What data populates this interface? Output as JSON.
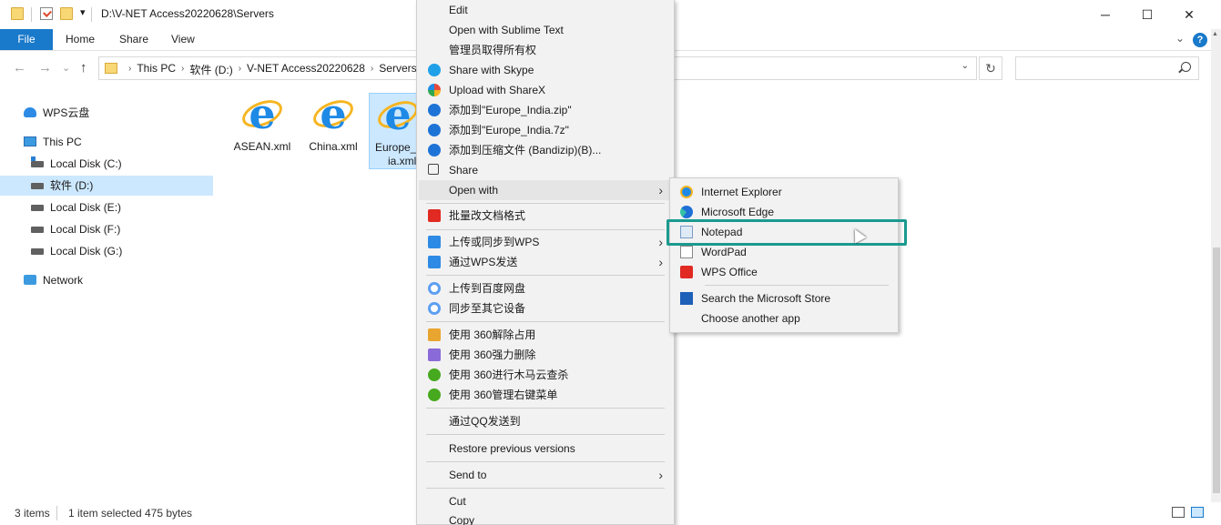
{
  "titlebar": {
    "path": "D:\\V-NET Access20220628\\Servers",
    "qa_dropdown": "▾",
    "minimize": "─",
    "maximize": "☐",
    "close": "✕"
  },
  "ribbon": {
    "tabs": [
      "File",
      "Home",
      "Share",
      "View"
    ],
    "collapse": "⌄",
    "help": "?"
  },
  "nav": {
    "back": "←",
    "forward": "→",
    "recent": "⌄",
    "up": "↑",
    "breadcrumbs": [
      "This PC",
      "软件 (D:)",
      "V-NET Access20220628",
      "Servers"
    ],
    "crumb_sep": "›",
    "dropdown": "⌄",
    "refresh": "↻",
    "search_placeholder": ""
  },
  "navpane": {
    "items": [
      {
        "label": "WPS云盘",
        "icon": "cloud-icon"
      },
      {
        "label": "This PC",
        "icon": "computer-icon"
      },
      {
        "label": "Local Disk (C:)",
        "icon": "system-disk-icon"
      },
      {
        "label": "软件 (D:)",
        "icon": "disk-icon",
        "selected": true
      },
      {
        "label": "Local Disk (E:)",
        "icon": "disk-icon"
      },
      {
        "label": "Local Disk (F:)",
        "icon": "disk-icon"
      },
      {
        "label": "Local Disk (G:)",
        "icon": "disk-icon"
      },
      {
        "label": "Network",
        "icon": "network-icon"
      }
    ]
  },
  "files": [
    {
      "name": "ASEAN.xml",
      "icon": "internet-explorer-icon"
    },
    {
      "name": "China.xml",
      "icon": "internet-explorer-icon"
    },
    {
      "name": "Europe_India.xml",
      "display_line1": "Europe_I",
      "display_line2": "ia.xml",
      "icon": "internet-explorer-icon",
      "selected": true
    }
  ],
  "status": {
    "items_count": "3 items",
    "selection": "1 item selected",
    "size": "475 bytes"
  },
  "context_menu": {
    "items": [
      {
        "label": "Edit"
      },
      {
        "label": "Open with Sublime Text"
      },
      {
        "label": "管理员取得所有权"
      },
      {
        "label": "Share with Skype",
        "icon": "skype-icon"
      },
      {
        "label": "Upload with ShareX",
        "icon": "sharex-icon"
      },
      {
        "label": "添加到\"Europe_India.zip\"",
        "icon": "bandizip-icon"
      },
      {
        "label": "添加到\"Europe_India.7z\"",
        "icon": "bandizip-icon"
      },
      {
        "label": "添加到压缩文件 (Bandizip)(B)...",
        "icon": "bandizip-icon"
      },
      {
        "label": "Share",
        "icon": "share-icon"
      },
      {
        "label": "Open with",
        "submenu": true
      },
      {
        "label": "批量改文档格式",
        "icon": "wps-icon"
      },
      {
        "label": "上传或同步到WPS",
        "icon": "wps-cloud-icon",
        "submenu": true
      },
      {
        "label": "通过WPS发送",
        "icon": "wps-send-icon",
        "submenu": true
      },
      {
        "label": "上传到百度网盘",
        "icon": "baidu-netdisk-icon"
      },
      {
        "label": "同步至其它设备",
        "icon": "baidu-netdisk-icon"
      },
      {
        "label": "使用 360解除占用",
        "icon": "360-unlock-icon"
      },
      {
        "label": "使用 360强力删除",
        "icon": "360-delete-icon"
      },
      {
        "label": "使用 360进行木马云查杀",
        "icon": "360-scan-icon"
      },
      {
        "label": "使用 360管理右键菜单",
        "icon": "360-manage-icon"
      },
      {
        "label": "通过QQ发送到"
      },
      {
        "label": "Restore previous versions"
      },
      {
        "label": "Send to",
        "submenu": true
      },
      {
        "label": "Cut"
      },
      {
        "label": "Copy"
      }
    ],
    "chevron": "›"
  },
  "open_with_menu": {
    "items": [
      {
        "label": "Internet Explorer",
        "icon": "internet-explorer-icon"
      },
      {
        "label": "Microsoft Edge",
        "icon": "edge-icon"
      },
      {
        "label": "Notepad",
        "icon": "notepad-icon"
      },
      {
        "label": "WordPad",
        "icon": "wordpad-icon"
      },
      {
        "label": "WPS Office",
        "icon": "wps-office-icon"
      },
      {
        "label": "Search the Microsoft Store",
        "icon": "store-icon"
      },
      {
        "label": "Choose another app",
        "icon": ""
      }
    ]
  },
  "colors": {
    "accent": "#1979ca",
    "selection": "#cce8ff",
    "highlight_box": "#1b9a8f",
    "menu_bg": "#f2f2f2"
  }
}
